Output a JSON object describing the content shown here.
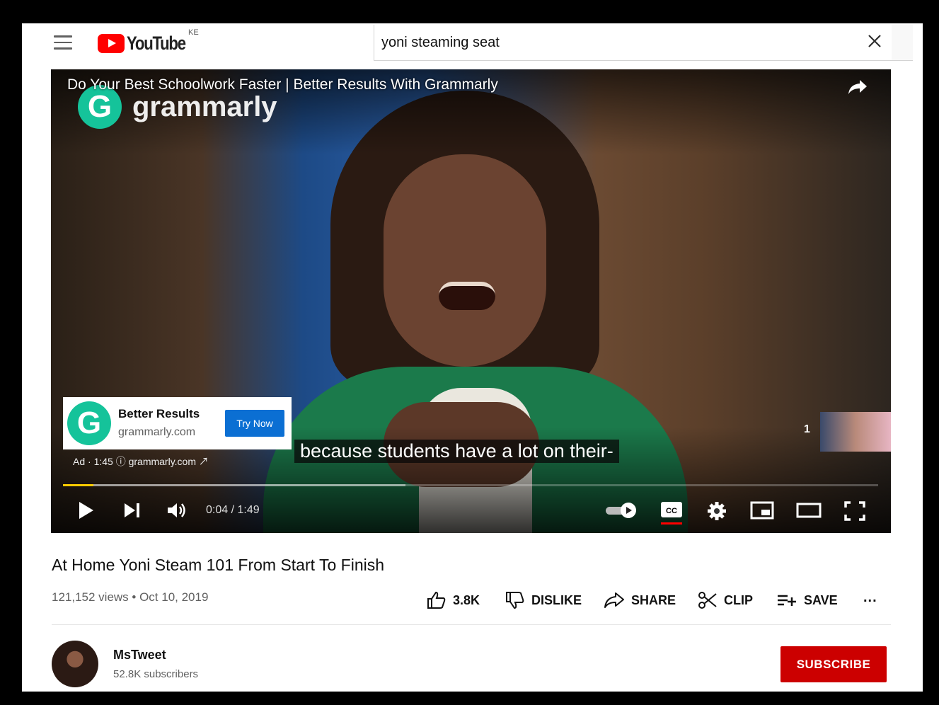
{
  "header": {
    "logo_text": "YouTube",
    "country_code": "KE",
    "search_query": "yoni steaming seat"
  },
  "player": {
    "ad_video_title": "Do Your Best Schoolwork Faster | Better Results With Grammarly",
    "brand_overlay": "grammarly",
    "ad_card": {
      "logo_letter": "G",
      "headline": "Better Results",
      "domain": "grammarly.com",
      "button_label": "Try Now"
    },
    "ad_meta": "Ad · 1:45 ⓘ  grammarly.com ↗",
    "caption": "because students have a lot on their-",
    "up_next_count": "1",
    "time_display": "0:04 / 1:49",
    "played_fraction": 0.037,
    "loaded_fraction": 0.42,
    "accent_colors": {
      "progress": "#ffcc00",
      "cc_underline": "#ff0000",
      "ad_button": "#0b6fd3"
    }
  },
  "video": {
    "title": "At Home Yoni Steam 101 From Start To Finish",
    "views_date": "121,152 views • Oct 10, 2019",
    "likes": "3.8K",
    "dislike_label": "DISLIKE",
    "share_label": "SHARE",
    "clip_label": "CLIP",
    "save_label": "SAVE",
    "more_label": "..."
  },
  "channel": {
    "name": "MsTweet",
    "subscribers": "52.8K subscribers",
    "subscribe_label": "SUBSCRIBE",
    "subscribe_color": "#cc0000"
  }
}
